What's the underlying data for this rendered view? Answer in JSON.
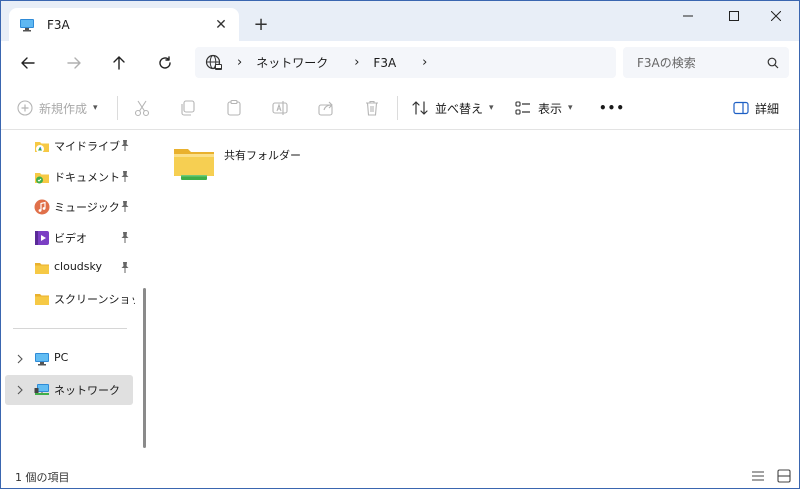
{
  "window": {
    "tab_title": "F3A",
    "new_tab": "+",
    "tab_close": "✕"
  },
  "address": {
    "crumbs": [
      "ネットワーク",
      "F3A"
    ],
    "separator": "›"
  },
  "search": {
    "placeholder": "F3Aの検索"
  },
  "commands": {
    "new_label": "新規作成",
    "sort_label": "並べ替え",
    "view_label": "表示",
    "details_label": "詳細",
    "more_label": "•••"
  },
  "sidebar": {
    "quick_access": [
      {
        "label": "マイドライブ",
        "icon": "google-drive-folder-icon",
        "pinned": true
      },
      {
        "label": "ドキュメント",
        "icon": "documents-folder-icon",
        "pinned": true
      },
      {
        "label": "ミュージック",
        "icon": "music-icon",
        "pinned": true
      },
      {
        "label": "ビデオ",
        "icon": "video-icon",
        "pinned": true
      },
      {
        "label": "cloudsky",
        "icon": "folder-icon",
        "pinned": true
      },
      {
        "label": "スクリーンショット",
        "icon": "folder-icon",
        "pinned": false
      }
    ],
    "locations": [
      {
        "label": "PC",
        "icon": "pc-icon"
      },
      {
        "label": "ネットワーク",
        "icon": "network-icon"
      }
    ]
  },
  "content": {
    "items": [
      {
        "name": "共有フォルダー",
        "icon": "shared-folder-icon"
      }
    ]
  },
  "status": {
    "item_count": "1 個の項目"
  },
  "colors": {
    "accent": "#3a66b0",
    "folder_yellow": "#f6c945",
    "network_green": "#3fae49",
    "selected_bg": "#e0e0e0"
  }
}
